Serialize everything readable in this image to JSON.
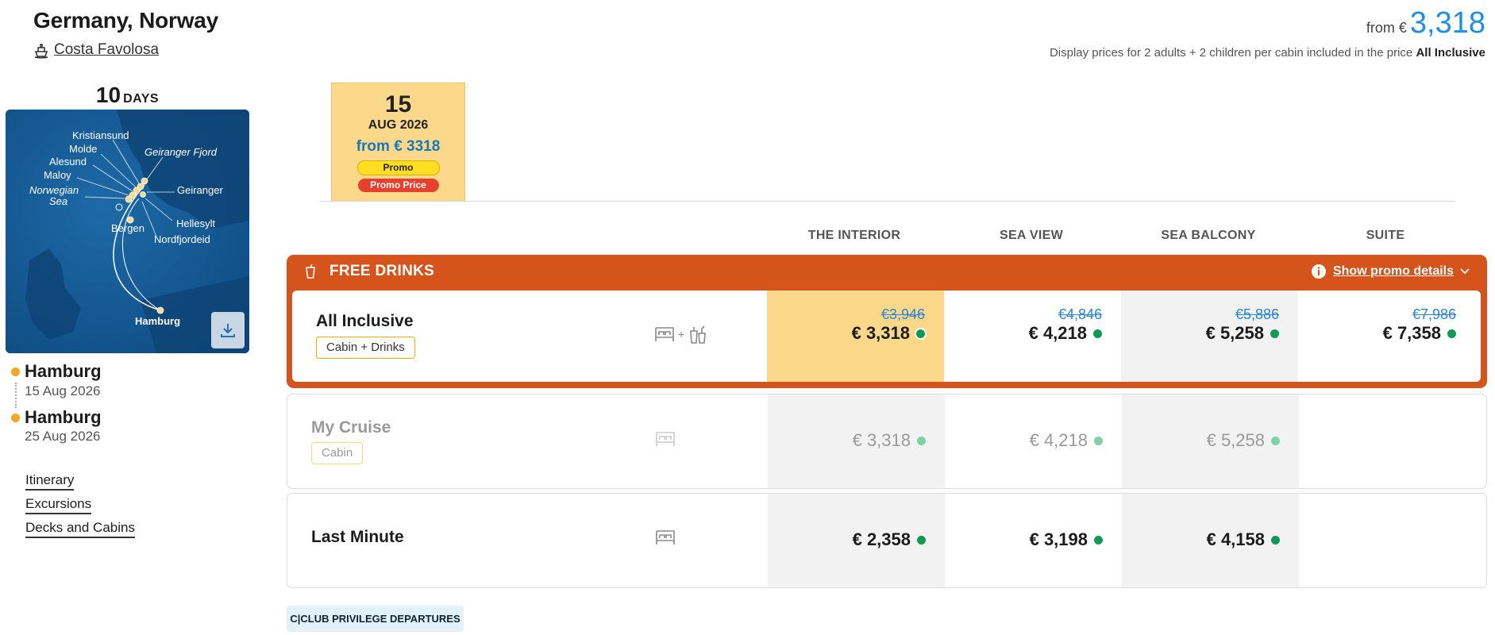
{
  "header": {
    "title": "Germany, Norway",
    "ship": "Costa Favolosa",
    "from_label": "from €",
    "from_price": "3,318",
    "disclaimer_text": "Display prices for 2 adults + 2 children per cabin included in the price",
    "disclaimer_bold": "All Inclusive"
  },
  "trip": {
    "days_number": "10",
    "days_label": "DAYS",
    "map_labels": {
      "kristiansund": "Kristiansund",
      "molde": "Molde",
      "alesund": "Alesund",
      "maloy": "Maloy",
      "norwegian_sea_1": "Norwegian",
      "norwegian_sea_2": "Sea",
      "geiranger_fjord": "Geiranger Fjord",
      "geiranger": "Geiranger",
      "hellesylt": "Hellesylt",
      "nordfjordeid": "Nordfjordeid",
      "bergen": "Bergen",
      "hamburg": "Hamburg"
    },
    "departure_port": "Hamburg",
    "departure_date": "15 Aug 2026",
    "arrival_port": "Hamburg",
    "arrival_date": "25 Aug 2026"
  },
  "links": [
    "Itinerary",
    "Excursions",
    "Decks and Cabins"
  ],
  "date_card": {
    "day": "15",
    "month": "AUG 2026",
    "from": "from € 3318",
    "promo_badge": "Promo",
    "promo_price_badge": "Promo Price"
  },
  "columns": [
    "THE INTERIOR",
    "SEA VIEW",
    "SEA BALCONY",
    "SUITE"
  ],
  "promo": {
    "title": "FREE DRINKS",
    "details_link": "Show promo details"
  },
  "rows": [
    {
      "name": "All Inclusive",
      "tag": "Cabin + Drinks",
      "plus": "+",
      "old": [
        "€3,946",
        "€4,846",
        "€5,886",
        "€7,986"
      ],
      "prices": [
        "€ 3,318",
        "€ 4,218",
        "€ 5,258",
        "€ 7,358"
      ]
    },
    {
      "name": "My Cruise",
      "tag": "Cabin",
      "prices": [
        "€ 3,318",
        "€ 4,218",
        "€ 5,258"
      ]
    },
    {
      "name": "Last Minute",
      "prices": [
        "€ 2,358",
        "€ 3,198",
        "€ 4,158"
      ]
    }
  ],
  "club_button": "C|CLUB PRIVILEGE DEPARTURES",
  "colors": {
    "accent_orange": "#d4541b",
    "highlight_yellow": "#fcd98a",
    "price_blue": "#1f8fe6",
    "availability_green": "#0d9a55"
  }
}
